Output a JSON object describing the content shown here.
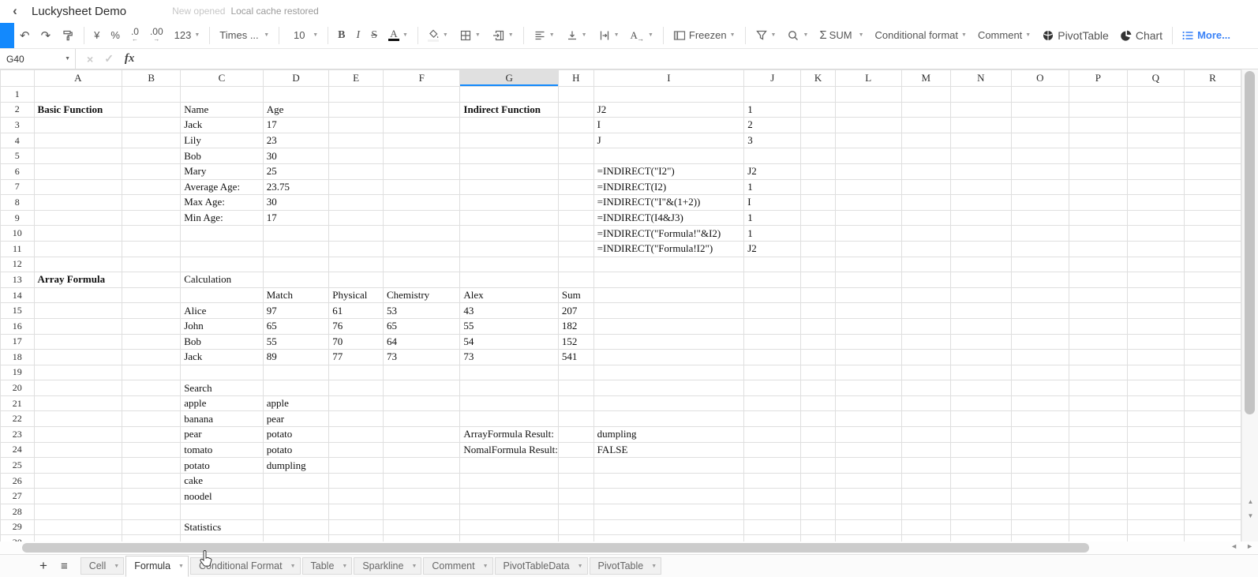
{
  "colors": {
    "accent_blue": "#1389fd",
    "more_link_blue": "#3a82f7",
    "selected_header_bg": "#e0e0e0",
    "grid_line": "#dfdfdf"
  },
  "header": {
    "title": "Luckysheet Demo",
    "status_new": "New opened",
    "status_cache": "Local cache restored"
  },
  "toolbar": {
    "undo": "↶",
    "redo": "↷",
    "currency": "¥",
    "percent": "%",
    "decrease_decimal": ".0",
    "decrease_decimal_arrow": "←",
    "increase_decimal": ".00",
    "increase_decimal_arrow": "→",
    "number_format": "123",
    "font_family": "Times ...",
    "font_size": "10",
    "bold": "B",
    "italic": "I",
    "strikethrough": "S",
    "text_color": "A",
    "rotate": "A",
    "rotate_arrow": "→",
    "freeze": "Freezen",
    "sigma": "Σ",
    "sum": "SUM",
    "conditional_format": "Conditional format",
    "comment": "Comment",
    "pivot_table": "PivotTable",
    "chart": "Chart",
    "more": "More..."
  },
  "formula_bar": {
    "name_box": "G40",
    "cancel": "×",
    "confirm": "✓",
    "fx": "fx"
  },
  "grid": {
    "columns": [
      "A",
      "B",
      "C",
      "D",
      "E",
      "F",
      "G",
      "H",
      "I",
      "J",
      "K",
      "L",
      "M",
      "N",
      "O",
      "P",
      "Q",
      "R"
    ],
    "selected_column": "G",
    "row_count": 30,
    "cells": {
      "2": {
        "A": {
          "v": "Basic Function",
          "b": 1
        },
        "C": {
          "v": "Name"
        },
        "D": {
          "v": "Age"
        },
        "G": {
          "v": "Indirect Function",
          "b": 1
        },
        "I": {
          "v": "J2"
        },
        "J": {
          "v": "1"
        }
      },
      "3": {
        "C": {
          "v": "Jack"
        },
        "D": {
          "v": "17"
        },
        "I": {
          "v": "I"
        },
        "J": {
          "v": "2"
        }
      },
      "4": {
        "C": {
          "v": "Lily"
        },
        "D": {
          "v": "23"
        },
        "I": {
          "v": "J"
        },
        "J": {
          "v": "3"
        }
      },
      "5": {
        "C": {
          "v": "Bob"
        },
        "D": {
          "v": "30"
        }
      },
      "6": {
        "C": {
          "v": "Mary"
        },
        "D": {
          "v": "25"
        },
        "I": {
          "v": "=INDIRECT(\"I2\")"
        },
        "J": {
          "v": "J2"
        }
      },
      "7": {
        "C": {
          "v": "Average Age:"
        },
        "D": {
          "v": "23.75"
        },
        "I": {
          "v": "=INDIRECT(I2)"
        },
        "J": {
          "v": "1"
        }
      },
      "8": {
        "C": {
          "v": "Max Age:"
        },
        "D": {
          "v": "30"
        },
        "I": {
          "v": "=INDIRECT(\"I\"&(1+2))"
        },
        "J": {
          "v": "I"
        }
      },
      "9": {
        "C": {
          "v": "Min Age:"
        },
        "D": {
          "v": "17"
        },
        "I": {
          "v": "=INDIRECT(I4&J3)"
        },
        "J": {
          "v": "1"
        }
      },
      "10": {
        "I": {
          "v": "=INDIRECT(\"Formula!\"&I2)"
        },
        "J": {
          "v": "1"
        }
      },
      "11": {
        "I": {
          "v": "=INDIRECT(\"Formula!I2\")"
        },
        "J": {
          "v": "J2"
        }
      },
      "13": {
        "A": {
          "v": "Array Formula",
          "b": 1
        },
        "C": {
          "v": "Calculation"
        }
      },
      "14": {
        "D": {
          "v": "Match"
        },
        "E": {
          "v": "Physical"
        },
        "F": {
          "v": "Chemistry"
        },
        "G": {
          "v": "Alex"
        },
        "H": {
          "v": "Sum"
        }
      },
      "15": {
        "C": {
          "v": "Alice"
        },
        "D": {
          "v": "97"
        },
        "E": {
          "v": "61"
        },
        "F": {
          "v": "53"
        },
        "G": {
          "v": "43"
        },
        "H": {
          "v": "207"
        }
      },
      "16": {
        "C": {
          "v": "John"
        },
        "D": {
          "v": "65"
        },
        "E": {
          "v": "76"
        },
        "F": {
          "v": "65"
        },
        "G": {
          "v": "55"
        },
        "H": {
          "v": "182"
        }
      },
      "17": {
        "C": {
          "v": "Bob"
        },
        "D": {
          "v": "55"
        },
        "E": {
          "v": "70"
        },
        "F": {
          "v": "64"
        },
        "G": {
          "v": "54"
        },
        "H": {
          "v": "152"
        }
      },
      "18": {
        "C": {
          "v": "Jack"
        },
        "D": {
          "v": "89"
        },
        "E": {
          "v": "77"
        },
        "F": {
          "v": "73"
        },
        "G": {
          "v": "73"
        },
        "H": {
          "v": "541"
        }
      },
      "20": {
        "C": {
          "v": "Search"
        }
      },
      "21": {
        "C": {
          "v": "apple"
        },
        "D": {
          "v": "apple"
        }
      },
      "22": {
        "C": {
          "v": "banana"
        },
        "D": {
          "v": "pear"
        }
      },
      "23": {
        "C": {
          "v": "pear"
        },
        "D": {
          "v": "potato"
        },
        "G": {
          "v": "ArrayFormula Result:"
        },
        "I": {
          "v": "dumpling"
        }
      },
      "24": {
        "C": {
          "v": "tomato"
        },
        "D": {
          "v": "potato"
        },
        "G": {
          "v": "NomalFormula Result:"
        },
        "I": {
          "v": "FALSE"
        }
      },
      "25": {
        "C": {
          "v": "potato"
        },
        "D": {
          "v": "dumpling"
        }
      },
      "26": {
        "C": {
          "v": "cake"
        }
      },
      "27": {
        "C": {
          "v": "noodel"
        }
      },
      "29": {
        "C": {
          "v": "Statistics"
        }
      }
    }
  },
  "sheet_tabs": {
    "add": "+",
    "menu": "≡",
    "tabs": [
      {
        "label": "Cell"
      },
      {
        "label": "Formula",
        "active": true
      },
      {
        "label": "Conditional Format"
      },
      {
        "label": "Table"
      },
      {
        "label": "Sparkline"
      },
      {
        "label": "Comment"
      },
      {
        "label": "PivotTableData"
      },
      {
        "label": "PivotTable"
      }
    ]
  }
}
